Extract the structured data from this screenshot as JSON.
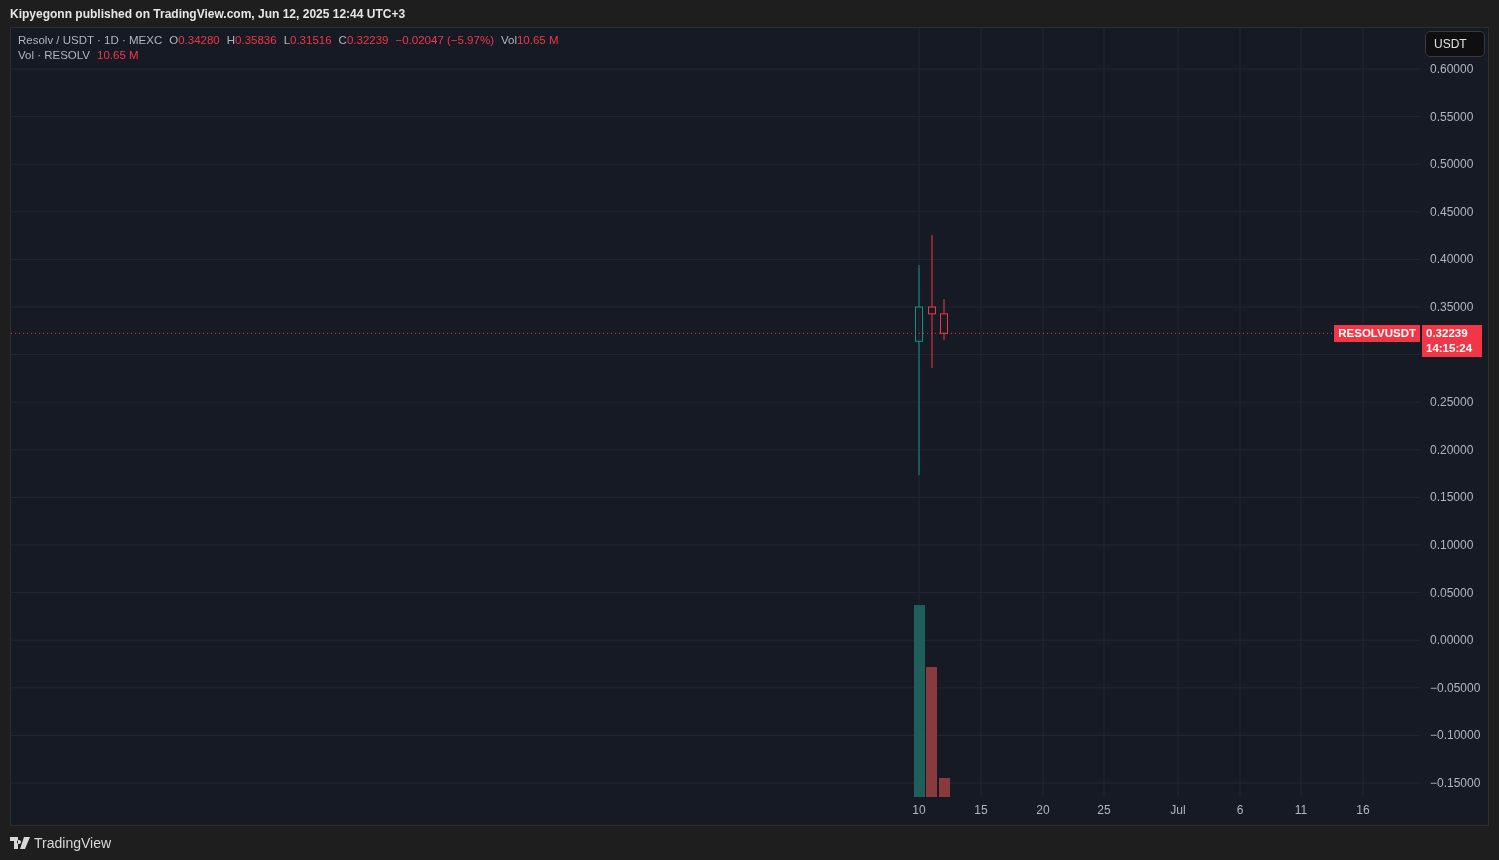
{
  "header": {
    "text": "Kipyegonn published on TradingView.com, Jun 12, 2025 12:44 UTC+3"
  },
  "legend": {
    "symbol": "Resolv / USDT · 1D · MEXC",
    "fields": [
      {
        "label": "O",
        "value": "0.34280"
      },
      {
        "label": "H",
        "value": "0.35836"
      },
      {
        "label": "L",
        "value": "0.31516"
      },
      {
        "label": "C",
        "value": "0.32239"
      }
    ],
    "change": "−0.02047 (−5.97%)",
    "volume": {
      "label": "Vol",
      "value": "10.65 M"
    },
    "volume_line": {
      "label": "Vol · RESOLV",
      "value": "10.65 M"
    }
  },
  "currency_button": "USDT",
  "price_badge": {
    "symbol": "RESOLVUSDT",
    "price": "0.32239",
    "countdown": "14:15:24"
  },
  "price_axis": [
    "0.60000",
    "0.55000",
    "0.50000",
    "0.45000",
    "0.40000",
    "0.35000",
    "0.25000",
    "0.20000",
    "0.15000",
    "0.10000",
    "0.05000",
    "0.00000",
    "−0.05000",
    "−0.10000",
    "−0.15000"
  ],
  "time_axis": [
    "10",
    "15",
    "20",
    "25",
    "Jul",
    "6",
    "11",
    "16"
  ],
  "footer": {
    "brand": "TradingView"
  }
}
